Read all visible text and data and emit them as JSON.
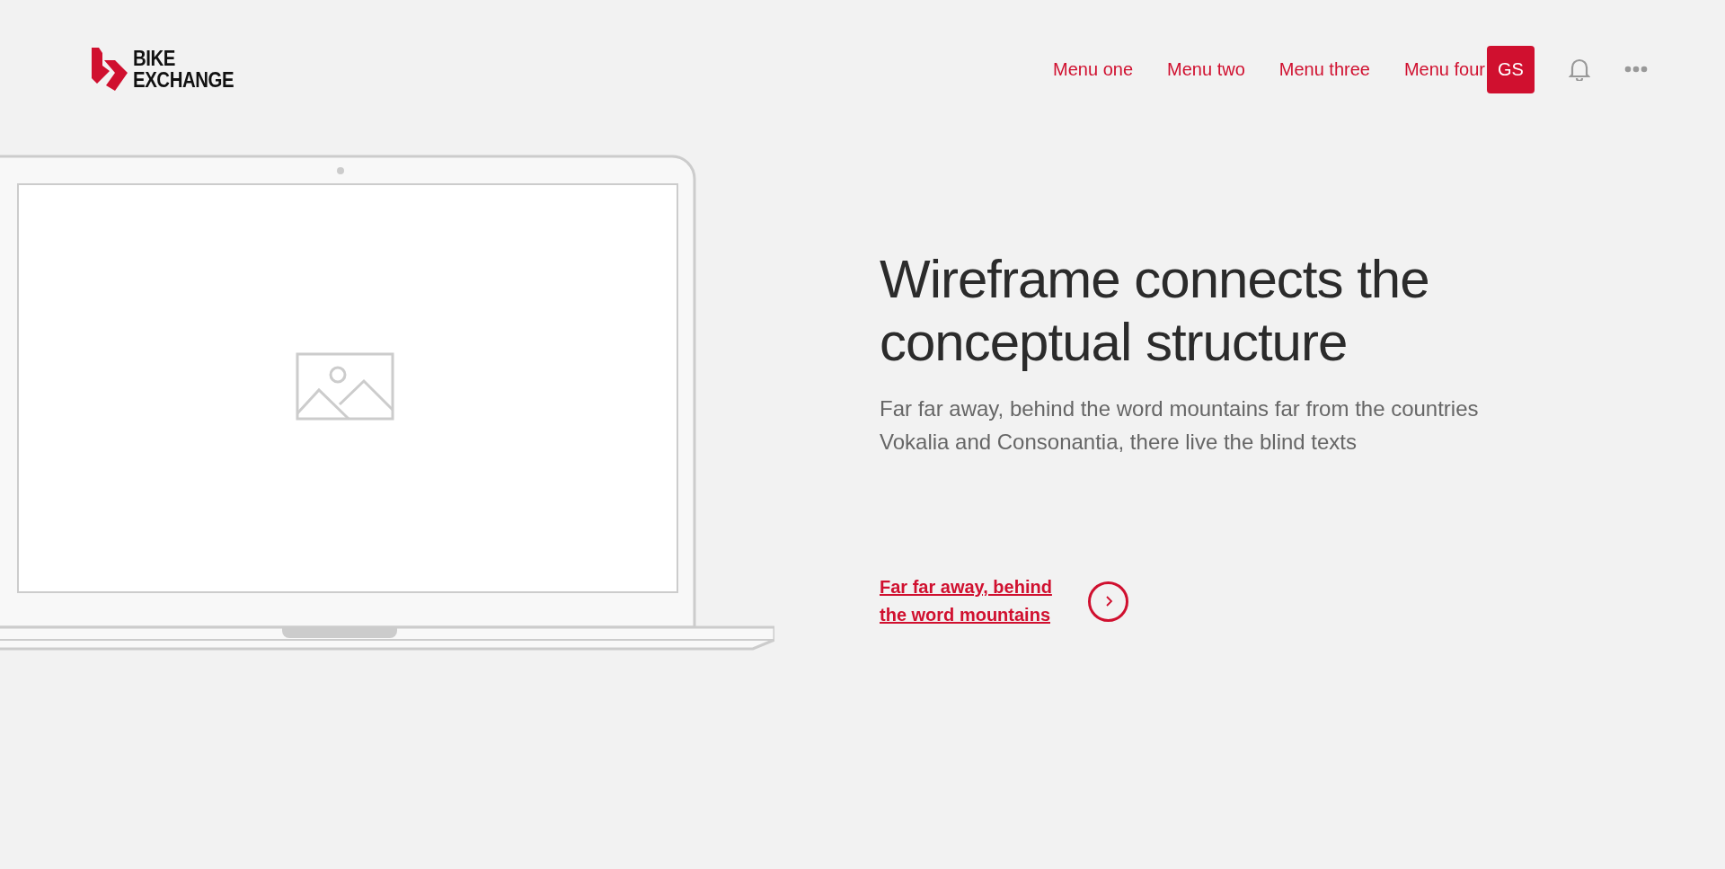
{
  "logo": {
    "line_1": "BIKE",
    "line_2": "EXCHANGE"
  },
  "nav": {
    "items": [
      {
        "label": "Menu one"
      },
      {
        "label": "Menu two"
      },
      {
        "label": "Menu three"
      },
      {
        "label": "Menu four"
      }
    ],
    "avatar": "GS"
  },
  "hero": {
    "title": "Wireframe connects the conceptual structure",
    "text": "Far far away, behind the word mountains far from the countries Vokalia and Consonantia, there live the blind texts",
    "link": "Far far away, behind the word mountains"
  }
}
